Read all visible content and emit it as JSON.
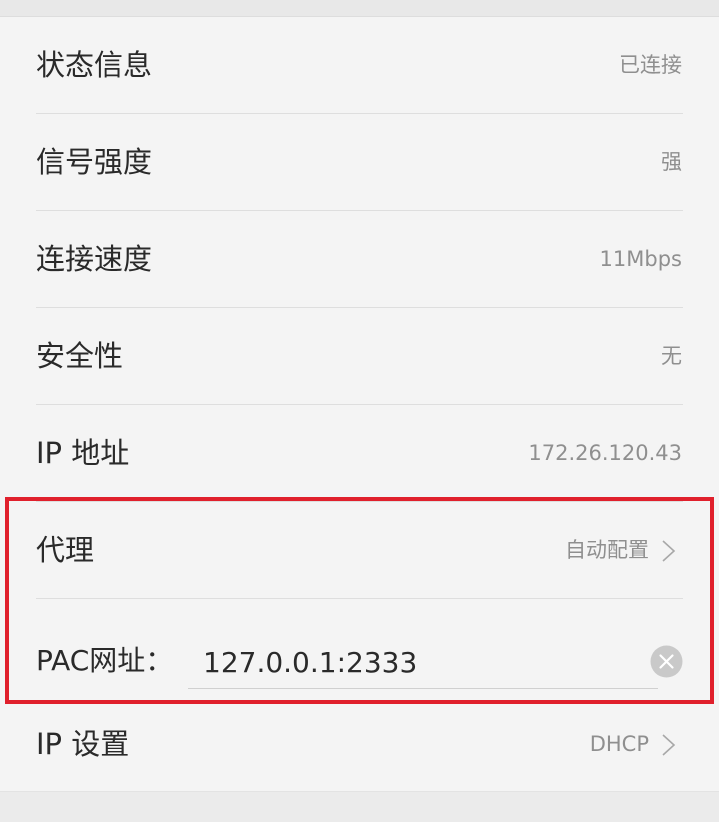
{
  "rows": [
    {
      "label": "状态信息",
      "value": "已连接"
    },
    {
      "label": "信号强度",
      "value": "强"
    },
    {
      "label": "连接速度",
      "value": "11Mbps"
    },
    {
      "label": "安全性",
      "value": "无"
    },
    {
      "label": "IP 地址",
      "value": "172.26.120.43"
    },
    {
      "label": "代理",
      "value": "自动配置",
      "icon": "chevron-right-icon"
    }
  ],
  "pac": {
    "label": "PAC网址：",
    "value": "127.0.0.1:2333",
    "clear_icon": "clear-icon"
  },
  "ip_settings": {
    "label": "IP 设置",
    "value": "DHCP",
    "icon": "chevron-right-icon"
  },
  "colors": {
    "highlight": "#e0202c",
    "background": "#f4f4f4"
  }
}
